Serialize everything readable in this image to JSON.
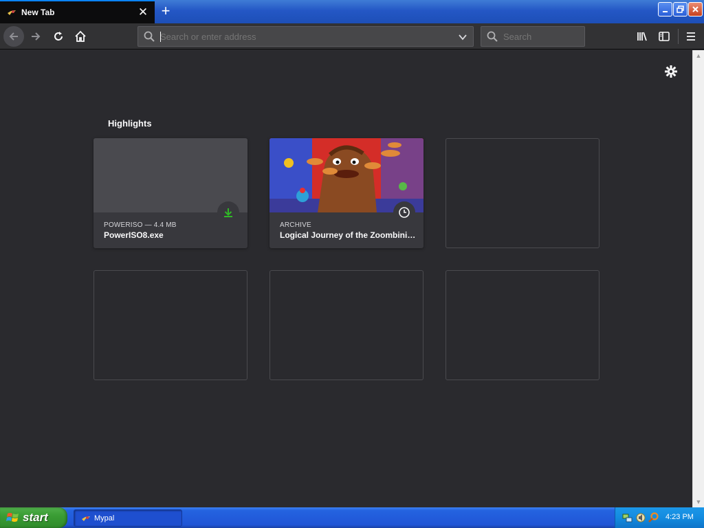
{
  "browser": {
    "tab_title": "New Tab",
    "url_placeholder": "Search or enter address",
    "search_placeholder": "Search"
  },
  "highlights": {
    "title": "Highlights",
    "cards": [
      {
        "context": "POWERISO — 4.4 MB",
        "title": "PowerISO8.exe",
        "badge": "download-icon"
      },
      {
        "context": "ARCHIVE",
        "title": "Logical Journey of the Zoombini…",
        "badge": "clock-icon"
      }
    ]
  },
  "taskbar": {
    "start_label": "start",
    "window_label": "Mypal",
    "clock": "4:23 PM"
  },
  "colors": {
    "content_bg": "#2a2a2e",
    "tab_accent": "#0a84ff",
    "download_green": "#30b826"
  }
}
